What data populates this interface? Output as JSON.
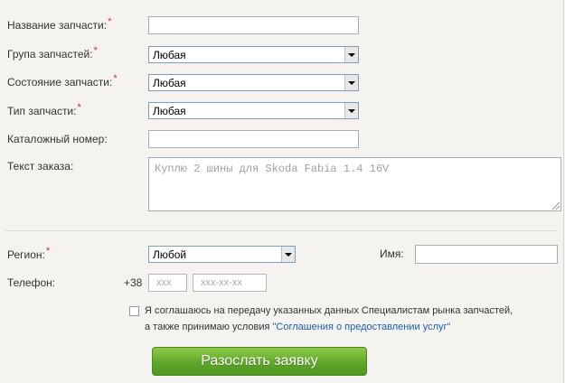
{
  "form": {
    "part_name_label": "Название запчасти:",
    "part_group_label": "Група запчастей:",
    "part_group_value": "Любая",
    "part_condition_label": "Состояние запчасти:",
    "part_condition_value": "Любая",
    "part_type_label": "Тип запчасти:",
    "part_type_value": "Любая",
    "catalog_number_label": "Каталожный номер:",
    "order_text_label": "Текст заказа:",
    "order_text_placeholder": "Куплю 2 шины для Skoda Fabia 1.4 16V",
    "region_label": "Регион:",
    "region_value": "Любой",
    "name_label": "Имя:",
    "phone_label": "Телефон:",
    "phone_prefix": "+38",
    "phone_code_placeholder": "xxx",
    "phone_number_placeholder": "xxx-xx-xx",
    "required_mark": "*",
    "consent_line1": "Я соглашаюсь на передачу указанных данных Специалистам рынка запчастей,",
    "consent_line2_prefix": "а также принимаю условия ",
    "consent_link": "\"Соглашения о предоставлении услуг\"",
    "submit_label": "Разослать заявку"
  },
  "colors": {
    "required": "#d9262a",
    "link": "#1a5fb4",
    "button": "#5fa62a"
  }
}
